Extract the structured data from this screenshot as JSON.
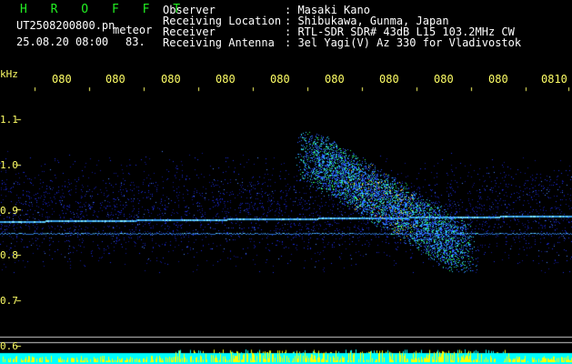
{
  "header": {
    "station": "H R O F F T",
    "filename": "UT2508200800.pn",
    "type": "meteor",
    "datetime": "25.08.20 08:00",
    "value": "83.",
    "fields": [
      {
        "label": "Observer",
        "value": ": Masaki Kano"
      },
      {
        "label": "Receiving Location",
        "value": ": Shibukawa, Gunma, Japan"
      },
      {
        "label": "Receiver",
        "value": ": RTL-SDR SDR# 43dB L15 103.2MHz CW"
      },
      {
        "label": "Receiving Antenna",
        "value": ": 3el Yagi(V) Az 330 for Vladivostok"
      }
    ]
  },
  "axes": {
    "y_unit": "kHz",
    "y_ticks": [
      "1.1",
      "1.0",
      "0.9",
      "0.8",
      "0.7",
      "0.6"
    ],
    "x_ticks": [
      "080",
      "080",
      "080",
      "080",
      "080",
      "080",
      "080",
      "080",
      "080",
      "0810"
    ]
  },
  "colors": {
    "background": "#000000",
    "header_text": "#ffffff",
    "label_text": "#ffff66",
    "station_text": "#22ee22",
    "noise": "#1a2ad8",
    "carrier": "#5fd0ff",
    "meteor": "#33ff66",
    "bar_cyan": "#00ffff",
    "bar_yellow": "#ffff00"
  }
}
